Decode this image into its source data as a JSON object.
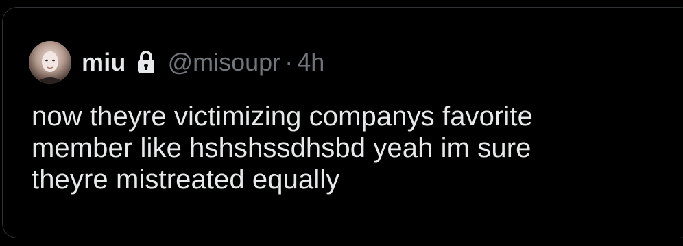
{
  "colors": {
    "background": "#000000",
    "card_border": "#2f3336",
    "primary_text": "#e7e9ea",
    "secondary_text": "#71767b"
  },
  "quote": {
    "display_name": "miu",
    "lock_icon": "lock-icon",
    "handle": "@misoupr",
    "separator": "·",
    "time": "4h",
    "text_lines": [
      "now theyre victimizing companys favorite",
      "member like hshshssdhsbd yeah im sure",
      "theyre mistreated equally"
    ]
  }
}
